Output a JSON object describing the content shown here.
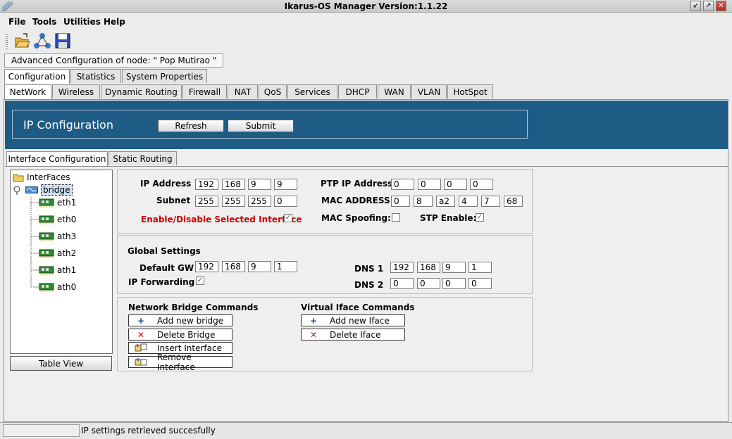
{
  "window": {
    "title": "Ikarus-OS Manager   Version:1.1.22",
    "btn_minimize": "↙",
    "btn_maximize": "↗",
    "btn_close": "✕"
  },
  "menu": [
    "File",
    "Tools",
    "Utilities",
    "Help"
  ],
  "toolbar": {
    "icons": [
      "open-folder-icon",
      "network-topology-icon",
      "save-disk-icon"
    ]
  },
  "node": {
    "label": "Advanced Configuration of node:  \" Pop Mutirao \""
  },
  "top_tabs": [
    "Configuration",
    "Statistics",
    "System Properties"
  ],
  "section_tabs": [
    "NetWork",
    "Wireless",
    "Dynamic Routing",
    "Firewall",
    "NAT",
    "QoS",
    "Services",
    "DHCP",
    "WAN",
    "VLAN",
    "HotSpot"
  ],
  "ip_config": {
    "title": "IP Configuration",
    "refresh": "Refresh",
    "submit": "Submit"
  },
  "sub_tabs": [
    "Interface Configuration",
    "Static Routing"
  ],
  "tree": {
    "root": "InterFaces",
    "bridge": "bridge",
    "children": [
      "eth1",
      "eth0",
      "ath3",
      "ath2",
      "ath1",
      "ath0"
    ],
    "table_view": "Table View"
  },
  "interface": {
    "ip_label": "IP Address",
    "ip": [
      "192",
      "168",
      "9",
      "9"
    ],
    "subnet_label": "Subnet",
    "subnet": [
      "255",
      "255",
      "255",
      "0"
    ],
    "enable_label": "Enable/Disable Selected Interface",
    "ptp_label": "PTP IP Address",
    "ptp": [
      "0",
      "0",
      "0",
      "0"
    ],
    "mac_label": "MAC ADDRESS",
    "mac": [
      "0",
      "8",
      "a2",
      "4",
      "7",
      "68"
    ],
    "spoof_label": "MAC Spoofing:",
    "stp_label": "STP Enable:",
    "check_mark": "✓"
  },
  "global": {
    "title": "Global Settings",
    "gw_label": "Default GW",
    "gw": [
      "192",
      "168",
      "9",
      "1"
    ],
    "fwd_label": "IP Forwarding",
    "dns1_label": "DNS 1",
    "dns1": [
      "192",
      "168",
      "9",
      "1"
    ],
    "dns2_label": "DNS 2",
    "dns2": [
      "0",
      "0",
      "0",
      "0"
    ]
  },
  "commands": {
    "bridge_title": "Network Bridge Commands",
    "add_bridge": "Add new bridge",
    "delete_bridge": "Delete Bridge",
    "insert_iface": "Insert Interface",
    "remove_iface": "Remove Interface",
    "virtual_title": "Virtual Iface Commands",
    "add_iface": "Add new Iface",
    "delete_iface": "Delete Iface",
    "plus": "+",
    "cross": "✕"
  },
  "status": {
    "message": "IP settings retrieved succesfully"
  }
}
